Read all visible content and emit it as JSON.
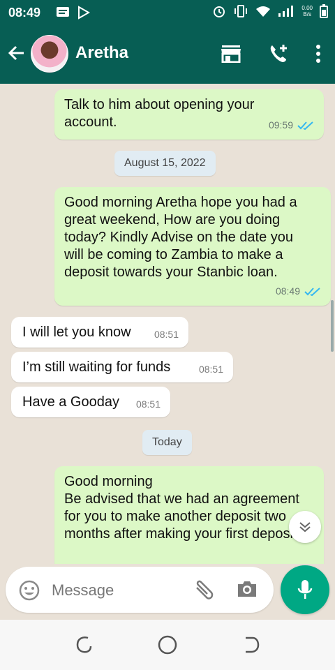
{
  "status_bar": {
    "time": "08:49",
    "net_speed_value": "0.00",
    "net_speed_unit": "B/s"
  },
  "header": {
    "contact_name": "Aretha",
    "icons": [
      "back-arrow-icon",
      "store-icon",
      "add-call-icon",
      "more-vert-icon"
    ]
  },
  "messages": [
    {
      "direction": "out",
      "text": "Talk to him about opening your account.",
      "time": "09:59",
      "read": true
    },
    {
      "direction": "date",
      "text": "August 15, 2022"
    },
    {
      "direction": "out",
      "text": "Good morning Aretha hope you had a great weekend, How are you doing today? Kindly Advise on the date you will be coming to Zambia to make a deposit towards your Stanbic loan.",
      "time": "08:49",
      "read": true
    },
    {
      "direction": "in",
      "text": "I will let you know",
      "time": "08:51"
    },
    {
      "direction": "in",
      "text": "I’m still waiting for funds",
      "time": "08:51"
    },
    {
      "direction": "in",
      "text": "Have a Gooday",
      "time": "08:51"
    },
    {
      "direction": "date",
      "text": "Today"
    },
    {
      "direction": "out",
      "text": "Good morning\nBe advised that we had an agreement for you to make another deposit two months after making your first deposit."
    }
  ],
  "composer": {
    "placeholder": "Message",
    "icons": [
      "emoji-icon",
      "attach-icon",
      "camera-icon",
      "mic-icon"
    ]
  },
  "colors": {
    "header": "#075e54",
    "outgoing_bubble": "#dcf8c6",
    "incoming_bubble": "#ffffff",
    "accent": "#00a884",
    "read_ticks": "#34b7f1"
  }
}
